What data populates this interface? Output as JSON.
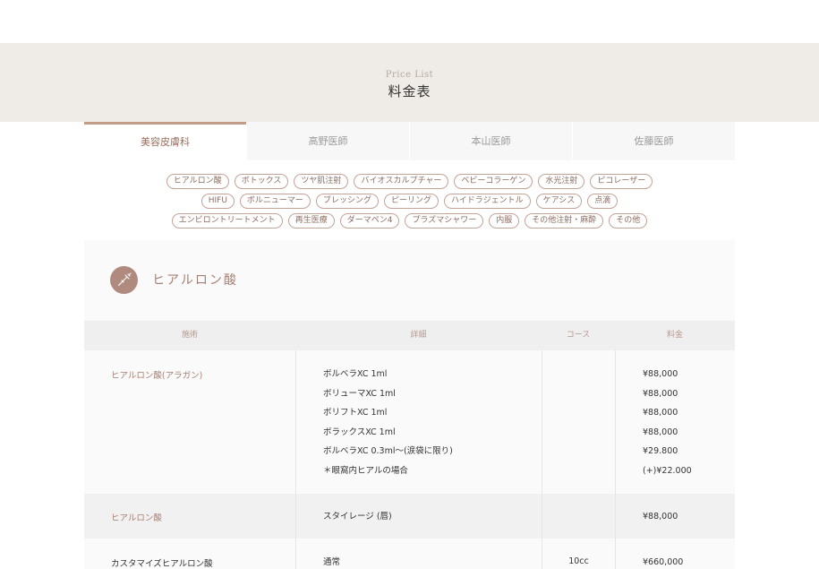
{
  "header": {
    "subtitle": "Price List",
    "title": "料金表"
  },
  "tabs": [
    {
      "label": "美容皮膚科",
      "active": true
    },
    {
      "label": "高野医師",
      "active": false
    },
    {
      "label": "本山医師",
      "active": false
    },
    {
      "label": "佐藤医師",
      "active": false
    }
  ],
  "tag_rows": [
    [
      "ヒアルロン酸",
      "ボトックス",
      "ツヤ肌注射",
      "バイオスカルプチャー",
      "ベビーコラーゲン",
      "水光注射",
      "ピコレーザー"
    ],
    [
      "HIFU",
      "ボルニューマー",
      "ブレッシング",
      "ピーリング",
      "ハイドラジェントル",
      "ケアシス",
      "点滴"
    ],
    [
      "エンビロントリートメント",
      "再生医療",
      "ダーマペン4",
      "プラズマシャワー",
      "内服",
      "その他注射・麻酔",
      "その他"
    ]
  ],
  "section": {
    "title": "ヒアルロン酸",
    "icon": "syringe-icon",
    "columns": [
      "施術",
      "詳細",
      "コース",
      "料金"
    ],
    "rows": [
      {
        "name": "ヒアルロン酸(アラガン)",
        "details": [
          "ボルベラXC 1ml",
          "ボリューマXC 1ml",
          "ボリフトXC 1ml",
          "ボラックスXC 1ml",
          "ボルベラXC 0.3ml〜(涙袋に限り)",
          "＊眼窩内ヒアルの場合"
        ],
        "course": "",
        "prices": [
          "¥88,000",
          "¥88,000",
          "¥88,000",
          "¥88,000",
          "¥29.800",
          "(+)¥22.000"
        ]
      },
      {
        "name": "ヒアルロン酸",
        "details": [
          "スタイレージ (唇)"
        ],
        "course": "",
        "prices": [
          "¥88,000"
        ]
      },
      {
        "name": "カスタマイズヒアルロン酸",
        "details": [
          "通常"
        ],
        "course": "10cc",
        "prices": [
          "¥660,000"
        ]
      }
    ]
  },
  "colors": {
    "accent": "#c49b89",
    "accent_text": "#a57f72",
    "band": "#efece7"
  }
}
